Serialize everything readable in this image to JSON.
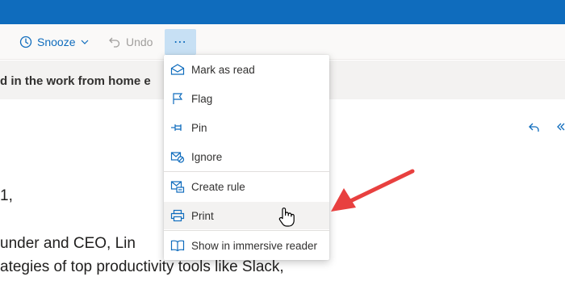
{
  "toolbar": {
    "snooze_label": "Snooze",
    "undo_label": "Undo",
    "more_label": "⋯"
  },
  "message": {
    "subject_fragment": "d in the work from home e",
    "body_lines": [
      "1,",
      "under and CEO, Lin",
      "ategies of top productivity tools like Slack,"
    ]
  },
  "more_menu": {
    "items": [
      {
        "label": "Mark as read",
        "icon": "envelope-open-icon"
      },
      {
        "label": "Flag",
        "icon": "flag-icon"
      },
      {
        "label": "Pin",
        "icon": "pin-icon"
      },
      {
        "label": "Ignore",
        "icon": "ignore-icon"
      },
      {
        "label": "Create rule",
        "icon": "rule-icon"
      },
      {
        "label": "Print",
        "icon": "printer-icon"
      },
      {
        "label": "Show in immersive reader",
        "icon": "immersive-reader-icon"
      }
    ],
    "hovered": "Print"
  },
  "colors": {
    "header_blue": "#0f6cbd",
    "accent": "#0f6cbd",
    "annotation_arrow": "#e8403f"
  }
}
